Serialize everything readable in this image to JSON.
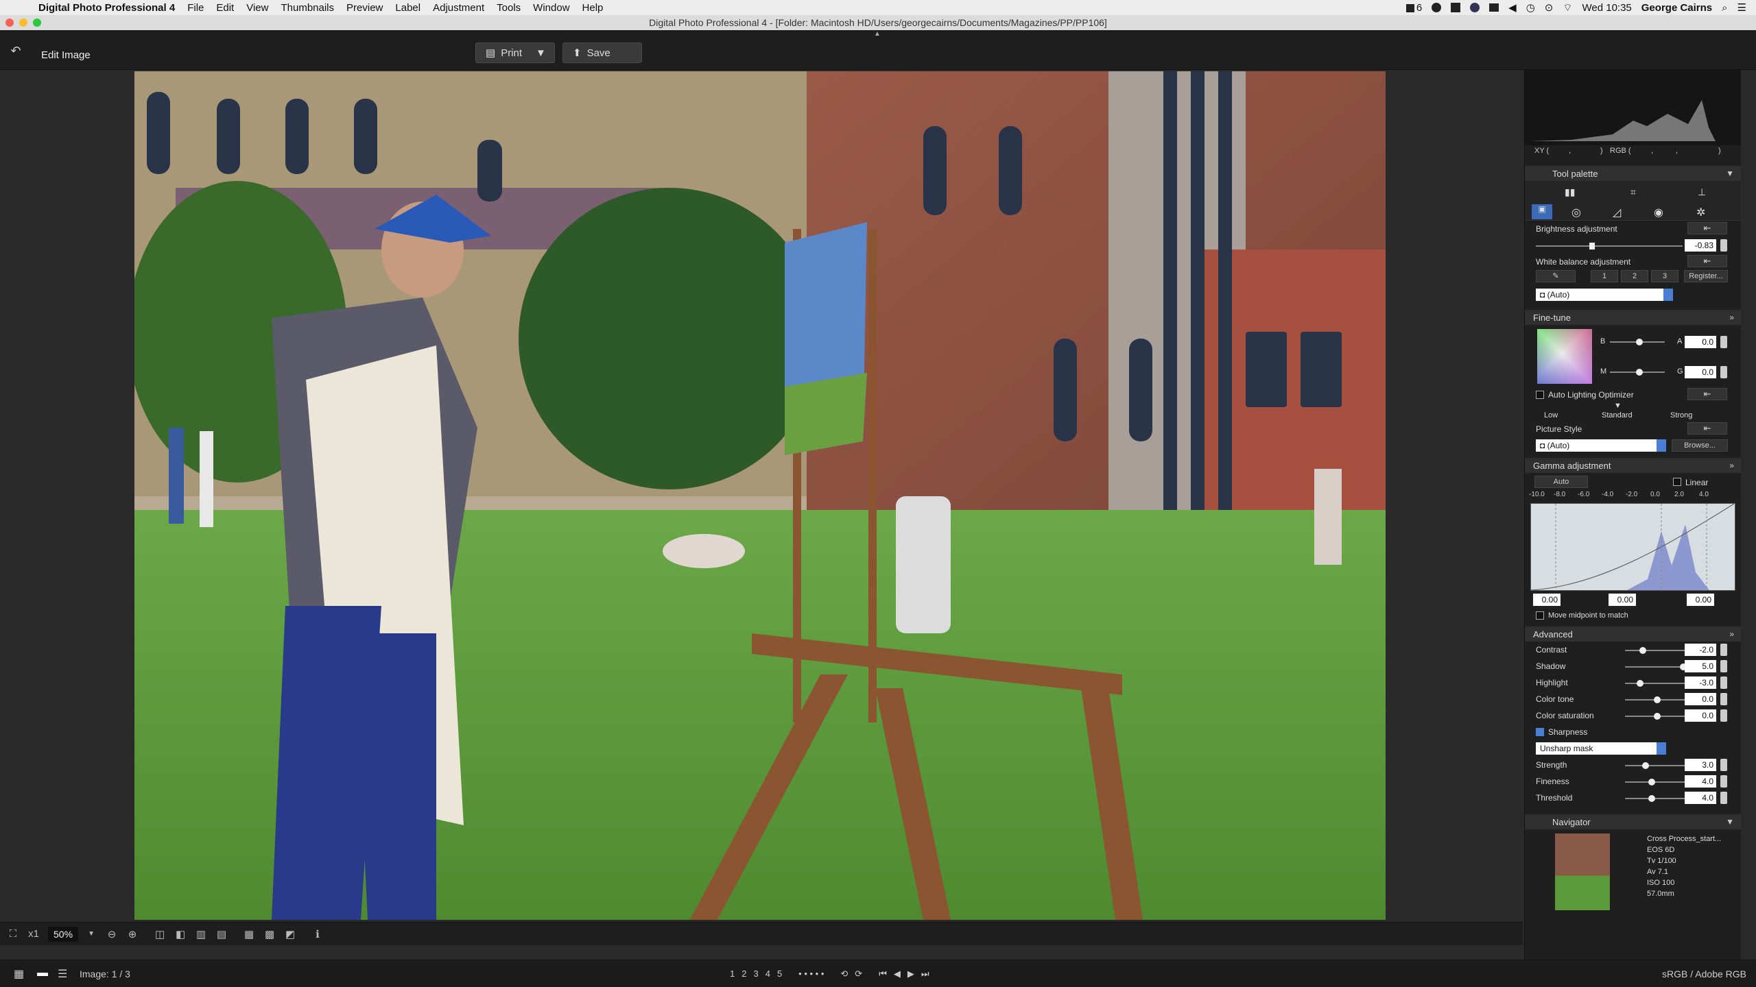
{
  "menubar": {
    "app_name": "Digital Photo Professional 4",
    "items": [
      "File",
      "Edit",
      "View",
      "Thumbnails",
      "Preview",
      "Label",
      "Adjustment",
      "Tools",
      "Window",
      "Help"
    ],
    "clock": "Wed 10:35",
    "user": "George Cairns",
    "battery_indicator": "6"
  },
  "window": {
    "title": "Digital Photo Professional 4 - [Folder: Macintosh HD/Users/georgecairns/Documents/Magazines/PP/PP106]"
  },
  "toolbar": {
    "mode_label": "Edit Image",
    "print_label": "Print",
    "save_label": "Save"
  },
  "viewer": {
    "zoom_level": "50%",
    "scale_label": "x1"
  },
  "status": {
    "image_counter": "Image: 1 / 3",
    "color_space": "sRGB / Adobe RGB",
    "ratings": [
      "1",
      "2",
      "3",
      "4",
      "5"
    ]
  },
  "sidebar": {
    "histogram": {
      "xy_label": "XY (",
      "xy_sep": ",",
      "xy_close": ")",
      "rgb_label": "RGB (",
      "rgb_sep1": ",",
      "rgb_sep2": ",",
      "rgb_close": ")"
    },
    "tool_palette": {
      "title": "Tool palette"
    },
    "brightness": {
      "label": "Brightness adjustment",
      "value": "-0.83"
    },
    "white_balance": {
      "label": "White balance adjustment",
      "buttons": [
        "1",
        "2",
        "3"
      ],
      "register_label": "Register...",
      "preset": "(Auto)"
    },
    "fine_tune": {
      "title": "Fine-tune",
      "b_label": "B",
      "a_label": "A",
      "a_value": "0.0",
      "m_label": "M",
      "g_label": "G",
      "g_value": "0.0"
    },
    "alo": {
      "label": "Auto Lighting Optimizer",
      "low": "Low",
      "standard": "Standard",
      "strong": "Strong"
    },
    "picture_style": {
      "label": "Picture Style",
      "value": "(Auto)",
      "browse": "Browse..."
    },
    "gamma": {
      "title": "Gamma adjustment",
      "auto_label": "Auto",
      "linear_label": "Linear",
      "ticks": [
        "-10.0",
        "-8.0",
        "-6.0",
        "-4.0",
        "-2.0",
        "0.0",
        "2.0",
        "4.0"
      ],
      "vals": [
        "0.00",
        "0.00",
        "0.00"
      ],
      "move_midpoint": "Move midpoint to match"
    },
    "advanced": {
      "title": "Advanced",
      "rows": [
        {
          "label": "Contrast",
          "value": "-2.0",
          "pos": 0.25
        },
        {
          "label": "Shadow",
          "value": "5.0",
          "pos": 0.95
        },
        {
          "label": "Highlight",
          "value": "-3.0",
          "pos": 0.2
        },
        {
          "label": "Color tone",
          "value": "0.0",
          "pos": 0.5
        },
        {
          "label": "Color saturation",
          "value": "0.0",
          "pos": 0.5
        }
      ],
      "sharpness_label": "Sharpness",
      "sharpness_mode": "Unsharp mask",
      "sharp_rows": [
        {
          "label": "Strength",
          "value": "3.0",
          "pos": 0.3
        },
        {
          "label": "Fineness",
          "value": "4.0",
          "pos": 0.4
        },
        {
          "label": "Threshold",
          "value": "4.0",
          "pos": 0.4
        }
      ]
    },
    "navigator": {
      "title": "Navigator",
      "info": [
        "Cross Process_start...",
        "EOS 6D",
        "Tv 1/100",
        "Av 7.1",
        "ISO 100",
        "57.0mm"
      ]
    }
  }
}
